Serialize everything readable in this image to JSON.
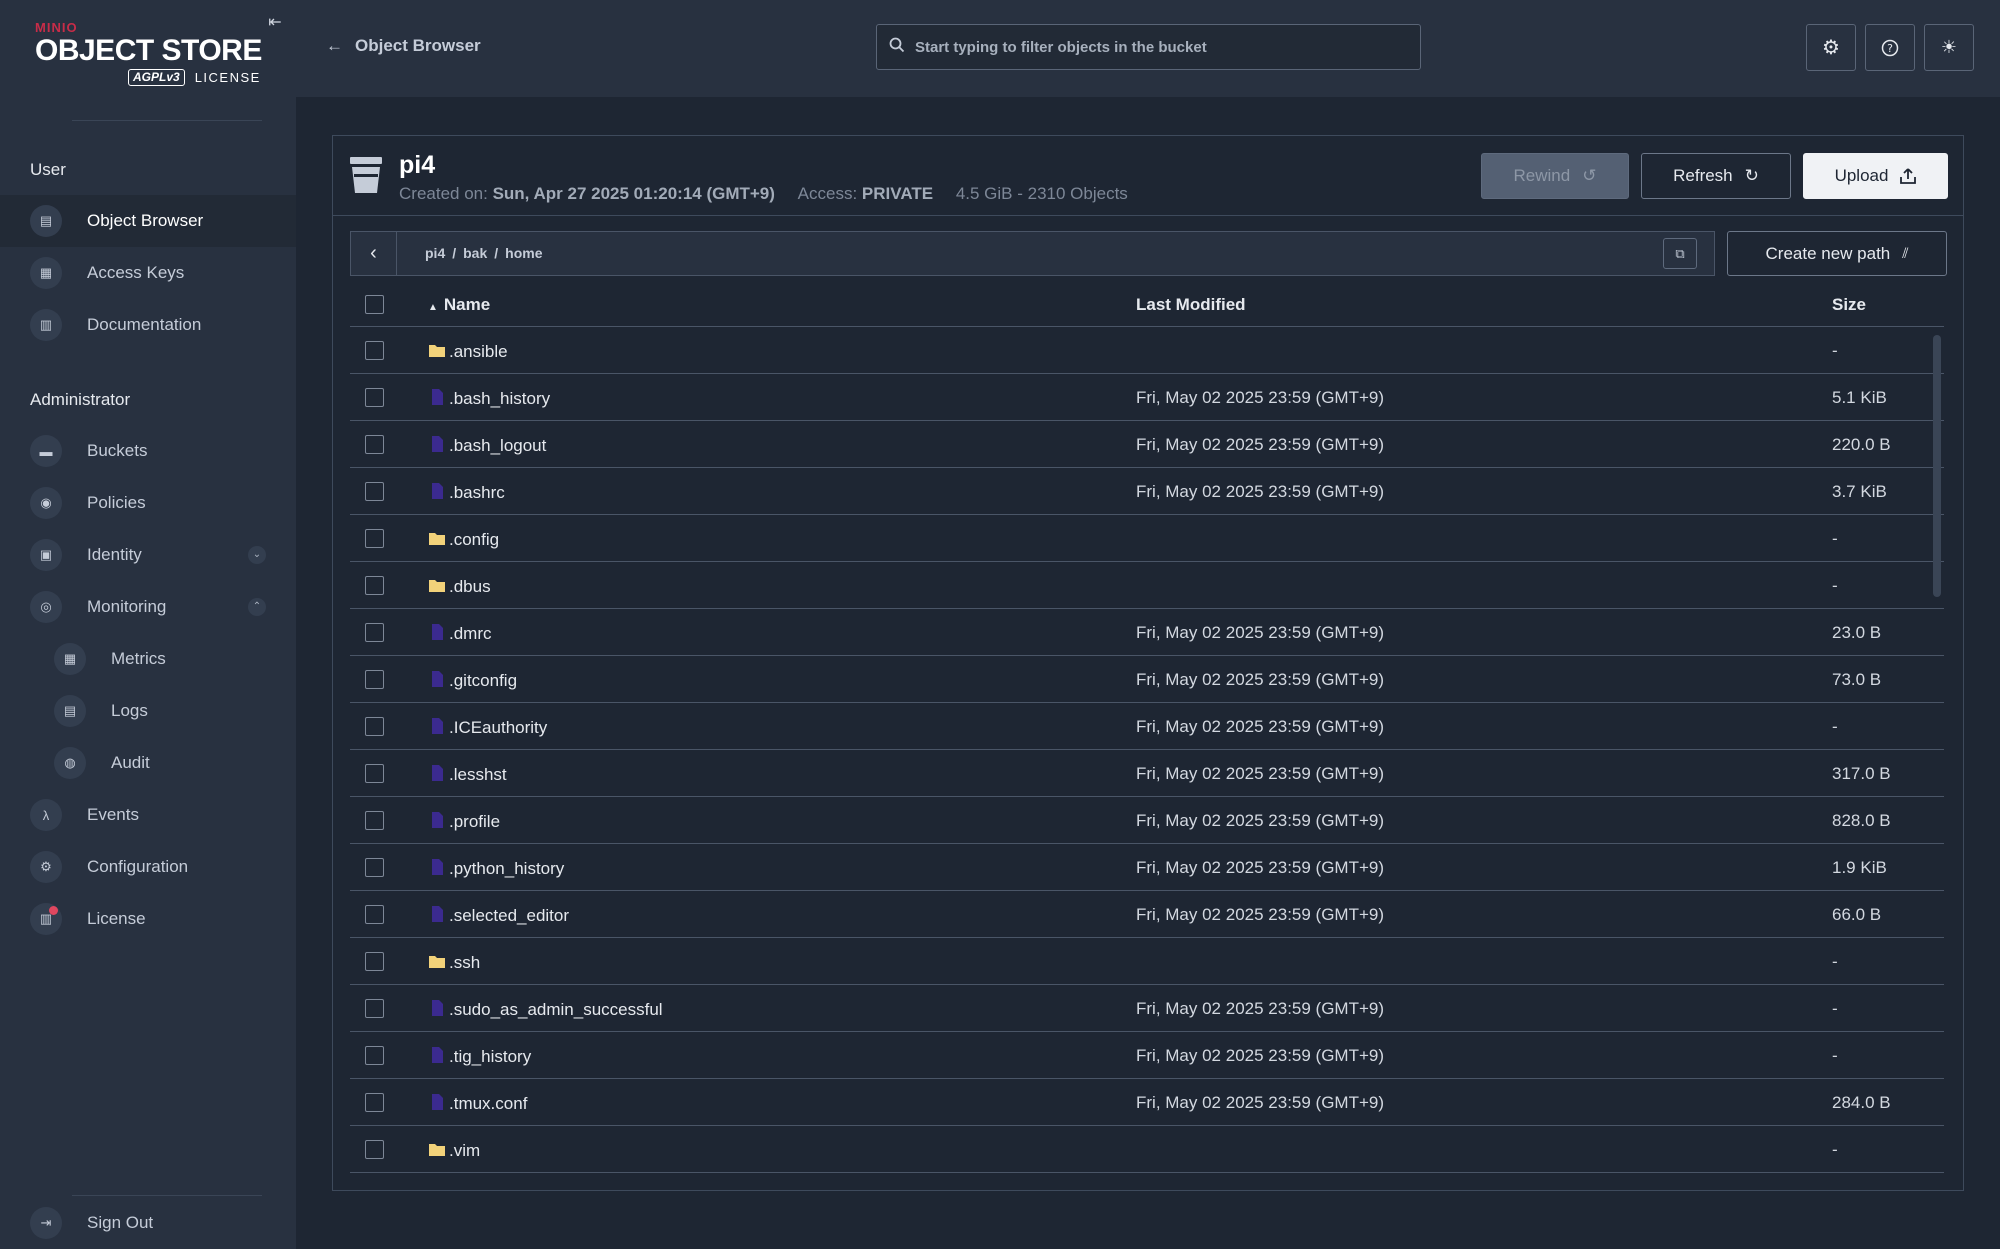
{
  "sidebar": {
    "logo": {
      "brand": "MINIO",
      "product": "OBJECT STORE",
      "agpl": "AGPLv3",
      "license": "LICENSE"
    },
    "user_section": "User",
    "user_items": [
      {
        "label": "Object Browser",
        "icon": "object-browser-icon",
        "active": true
      },
      {
        "label": "Access Keys",
        "icon": "access-keys-icon"
      },
      {
        "label": "Documentation",
        "icon": "documentation-icon"
      }
    ],
    "admin_section": "Administrator",
    "admin_items": [
      {
        "label": "Buckets",
        "icon": "buckets-icon"
      },
      {
        "label": "Policies",
        "icon": "policies-icon"
      },
      {
        "label": "Identity",
        "icon": "identity-icon",
        "chevron": "down"
      },
      {
        "label": "Monitoring",
        "icon": "monitoring-icon",
        "chevron": "up"
      },
      {
        "label": "Metrics",
        "icon": "metrics-icon",
        "sub": true
      },
      {
        "label": "Logs",
        "icon": "logs-icon",
        "sub": true
      },
      {
        "label": "Audit",
        "icon": "audit-icon",
        "sub": true
      },
      {
        "label": "Events",
        "icon": "lambda-icon"
      },
      {
        "label": "Configuration",
        "icon": "configuration-icon"
      },
      {
        "label": "License",
        "icon": "license-icon",
        "badge": true
      }
    ],
    "sign_out": "Sign Out"
  },
  "header": {
    "back_label": "Object Browser",
    "search_placeholder": "Start typing to filter objects in the bucket",
    "buttons": [
      "settings-icon",
      "help-icon",
      "theme-icon"
    ]
  },
  "bucket": {
    "name": "pi4",
    "created_label": "Created on:",
    "created_value": "Sun, Apr 27 2025 01:20:14 (GMT+9)",
    "access_label": "Access:",
    "access_value": "PRIVATE",
    "usage": "4.5 GiB - 2310 Objects",
    "rewind_label": "Rewind",
    "refresh_label": "Refresh",
    "upload_label": "Upload"
  },
  "breadcrumb": {
    "parts": [
      "pi4",
      "bak",
      "home"
    ],
    "separator": "/",
    "create_path_label": "Create new path"
  },
  "table": {
    "columns": {
      "name": "Name",
      "modified": "Last Modified",
      "size": "Size"
    },
    "rows": [
      {
        "type": "folder",
        "name": ".ansible",
        "modified": "",
        "size": "-"
      },
      {
        "type": "file",
        "name": ".bash_history",
        "modified": "Fri, May 02 2025 23:59 (GMT+9)",
        "size": "5.1 KiB"
      },
      {
        "type": "file",
        "name": ".bash_logout",
        "modified": "Fri, May 02 2025 23:59 (GMT+9)",
        "size": "220.0 B"
      },
      {
        "type": "file",
        "name": ".bashrc",
        "modified": "Fri, May 02 2025 23:59 (GMT+9)",
        "size": "3.7 KiB"
      },
      {
        "type": "folder",
        "name": ".config",
        "modified": "",
        "size": "-"
      },
      {
        "type": "folder",
        "name": ".dbus",
        "modified": "",
        "size": "-"
      },
      {
        "type": "file",
        "name": ".dmrc",
        "modified": "Fri, May 02 2025 23:59 (GMT+9)",
        "size": "23.0 B"
      },
      {
        "type": "file",
        "name": ".gitconfig",
        "modified": "Fri, May 02 2025 23:59 (GMT+9)",
        "size": "73.0 B"
      },
      {
        "type": "file",
        "name": ".ICEauthority",
        "modified": "Fri, May 02 2025 23:59 (GMT+9)",
        "size": "-"
      },
      {
        "type": "file",
        "name": ".lesshst",
        "modified": "Fri, May 02 2025 23:59 (GMT+9)",
        "size": "317.0 B"
      },
      {
        "type": "file",
        "name": ".profile",
        "modified": "Fri, May 02 2025 23:59 (GMT+9)",
        "size": "828.0 B"
      },
      {
        "type": "file",
        "name": ".python_history",
        "modified": "Fri, May 02 2025 23:59 (GMT+9)",
        "size": "1.9 KiB"
      },
      {
        "type": "file",
        "name": ".selected_editor",
        "modified": "Fri, May 02 2025 23:59 (GMT+9)",
        "size": "66.0 B"
      },
      {
        "type": "folder",
        "name": ".ssh",
        "modified": "",
        "size": "-"
      },
      {
        "type": "file",
        "name": ".sudo_as_admin_successful",
        "modified": "Fri, May 02 2025 23:59 (GMT+9)",
        "size": "-"
      },
      {
        "type": "file",
        "name": ".tig_history",
        "modified": "Fri, May 02 2025 23:59 (GMT+9)",
        "size": "-"
      },
      {
        "type": "file",
        "name": ".tmux.conf",
        "modified": "Fri, May 02 2025 23:59 (GMT+9)",
        "size": "284.0 B"
      },
      {
        "type": "folder",
        "name": ".vim",
        "modified": "",
        "size": "-"
      }
    ]
  },
  "colors": {
    "sidebar_bg": "#283140",
    "page_bg": "#1e2633",
    "brand_red": "#c72c48",
    "folder_yellow": "#f2d27a",
    "file_purple": "#3b2a8f"
  }
}
